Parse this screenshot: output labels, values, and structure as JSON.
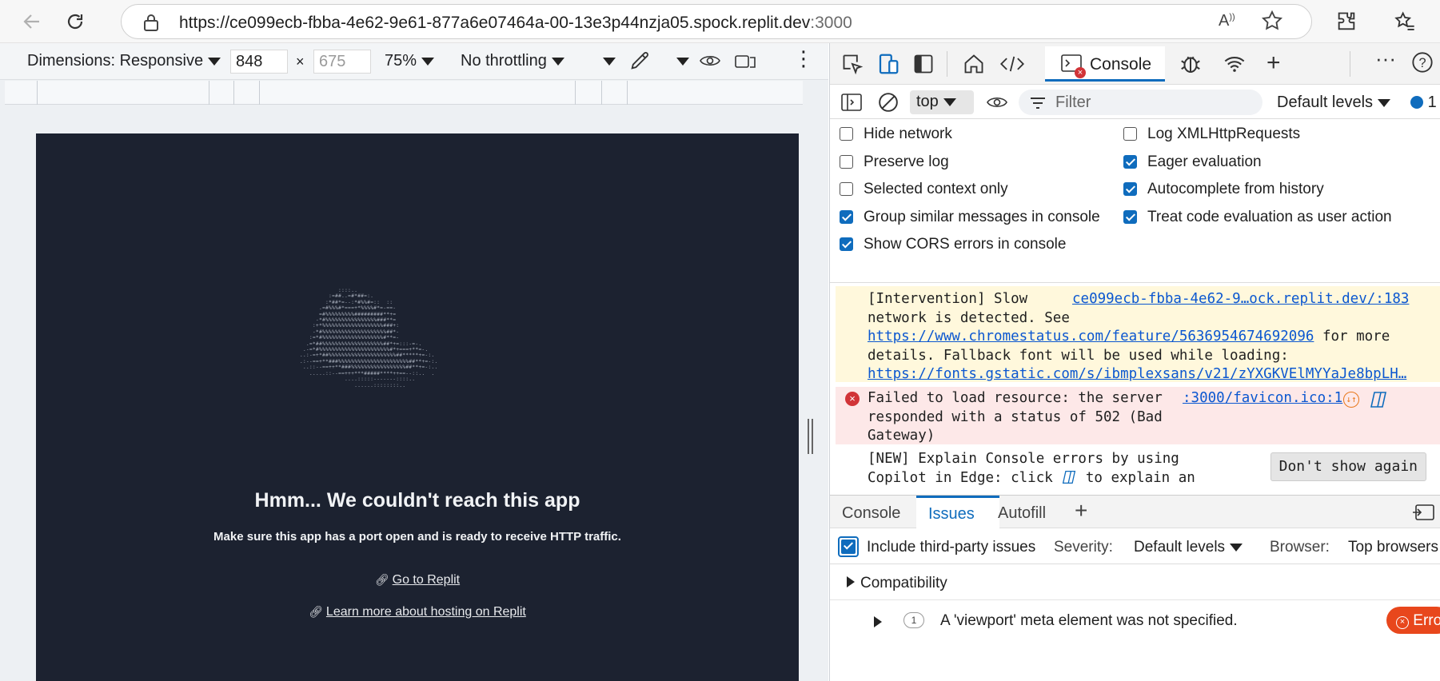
{
  "browser": {
    "url_main": "https://ce099ecb-fbba-4e62-9e61-877a6e07464a-00-13e3p44nzja05.spock.replit.dev",
    "url_port": ":3000"
  },
  "device_toolbar": {
    "dimensions": "Dimensions: Responsive",
    "width": "848",
    "height_placeholder": "675",
    "zoom": "75%",
    "throttling": "No throttling"
  },
  "page": {
    "title": "Hmm... We couldn't reach this app",
    "subtitle": "Make sure this app has a port open and is ready to receive HTTP traffic.",
    "link1": "Go to Replit",
    "link2": "Learn more about hosting on Replit",
    "ascii_art": [
      "            ::::..             ",
      "         :=##..=#*##=:.        ",
      "        :*##*=--:*#%%#=::  ::  ",
      "      .=#%%%#*===+*%%%%#*=-==- ",
      "      =#%%%%%%%%%#########**+= ",
      "     -*#%%%%%%%%%%%%%%%%###**= ",
      "    :+*%%%%%%%%%%%%%%%%%%%###+:",
      "    -*#%%%%%%%%%%%%%%%%%%%%##*-",
      "   :=*#%%%%%%%%%%%%%%%%%%%#**=-",
      "  .=*##%%%%%%%%%%%%%%%%%%%##*+=:::-=-.",
      " .-=*#%%%%%%%%%%%%%%%%%%%%%%#*+===+**=-.",
      "..:-=+*##%%%%%%%%%%%%%%%%%%%%%##*****+=-:.",
      ".:--==+**###%%%%%%%%%%%%%%%%%%%%%%##**+=-:.",
      " ..::--==++**###%%%%%%%%%%%%%%%%%##**+=-:..",
      "   .....::--==+++***#####****++==--::..  .",
      "              ....:::::-------::::..",
      "                 ......::::::::.."
    ]
  },
  "devtools": {
    "console_tab": "Console",
    "context": "top",
    "filter_placeholder": "Filter",
    "levels": "Default levels",
    "issues_count": "1",
    "settings_left": [
      {
        "label": "Hide network",
        "checked": false
      },
      {
        "label": "Preserve log",
        "checked": false
      },
      {
        "label": "Selected context only",
        "checked": false
      },
      {
        "label": "Group similar messages in console",
        "checked": true
      },
      {
        "label": "Show CORS errors in console",
        "checked": true
      }
    ],
    "settings_right": [
      {
        "label": "Log XMLHttpRequests",
        "checked": false
      },
      {
        "label": "Eager evaluation",
        "checked": true
      },
      {
        "label": "Autocomplete from history",
        "checked": true
      },
      {
        "label": "Treat code evaluation as user action",
        "checked": true
      }
    ],
    "warn": {
      "l1": "[Intervention] Slow",
      "source": "ce099ecb-fbba-4e62-9…ock.replit.dev/:183",
      "l2": "network is detected. See",
      "link1": "https://www.chromestatus.com/feature/5636954674692096",
      "l3_tail": " for more",
      "l4": "details. Fallback font will be used while loading:",
      "link2": "https://fonts.gstatic.com/s/ibmplexsans/v21/zYXGKVElMYYaJe8bpLH…"
    },
    "error": {
      "l1": "Failed to load resource: the server",
      "source": ":3000/favicon.ico:1",
      "l2": "responded with a status of 502 (Bad",
      "l3": "Gateway)"
    },
    "new_msg": {
      "l1": "[NEW] Explain Console errors by using",
      "l2a": "Copilot in Edge: click ",
      "l2b": " to explain an",
      "button": "Don't show again"
    },
    "drawer_tabs": [
      "Console",
      "Issues",
      "Autofill"
    ],
    "issues_bar": {
      "include": "Include third-party issues",
      "severity_label": "Severity:",
      "severity": "Default levels",
      "browser_label": "Browser:",
      "browser": "Top browsers"
    },
    "compat": "Compatibility",
    "issue": {
      "count": "1",
      "text": "A 'viewport' meta element was not specified.",
      "badge": "Error"
    }
  }
}
